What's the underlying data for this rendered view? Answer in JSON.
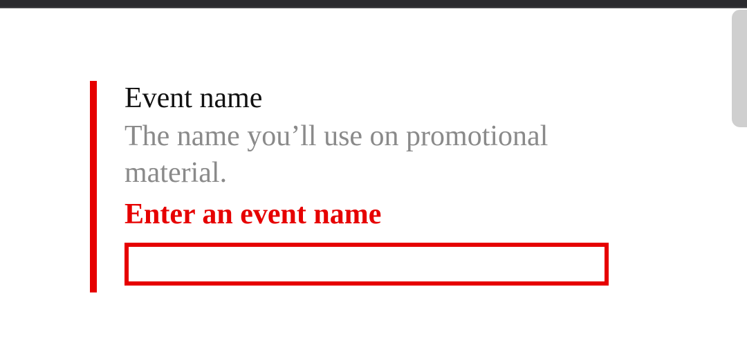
{
  "form": {
    "eventName": {
      "label": "Event name",
      "hint": "The name you’ll use on promotional material.",
      "error": "Enter an event name",
      "value": ""
    }
  },
  "colors": {
    "error": "#e60000",
    "hint": "#8a8a8a",
    "text": "#111111"
  }
}
